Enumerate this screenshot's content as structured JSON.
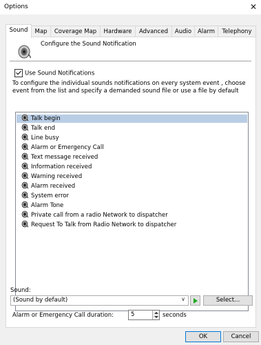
{
  "window": {
    "title": "Options",
    "close_glyph": "✕"
  },
  "tabs": [
    {
      "label": "Sound",
      "active": true
    },
    {
      "label": "Map"
    },
    {
      "label": "Coverage Map"
    },
    {
      "label": "Hardware"
    },
    {
      "label": "Advanced"
    },
    {
      "label": "Audio"
    },
    {
      "label": "Alarm"
    },
    {
      "label": "Telephony"
    }
  ],
  "header": {
    "icon": "speaker-icon",
    "text": "Configure the Sound Notification"
  },
  "use_sound_notifications": {
    "label": "Use Sound Notifications",
    "checked": true
  },
  "description": "To configure the individual sounds notifications on every system event , choose event from the list and specify a demanded sound file or use a file by default",
  "events": [
    {
      "label": "Talk begin",
      "selected": true
    },
    {
      "label": "Talk end"
    },
    {
      "label": "Line busy"
    },
    {
      "label": "Alarm or Emergency Call"
    },
    {
      "label": "Text message received"
    },
    {
      "label": "Information received"
    },
    {
      "label": "Warning received"
    },
    {
      "label": "Alarm received"
    },
    {
      "label": "System error"
    },
    {
      "label": "Alarm Tone"
    },
    {
      "label": "Private call from a radio Network to dispatcher"
    },
    {
      "label": "Request To Talk from Radio Network to dispatcher"
    }
  ],
  "sound": {
    "label": "Sound:",
    "selected": "(Sound by default)",
    "select_button": "Select...",
    "play_icon": "play-icon"
  },
  "duration": {
    "label": "Alarm or Emergency Call duration:",
    "value": "5",
    "unit": "seconds"
  },
  "buttons": {
    "ok": "OK",
    "cancel": "Cancel"
  },
  "colors": {
    "selection": "#b9cde5",
    "play": "#1eaa1e"
  }
}
